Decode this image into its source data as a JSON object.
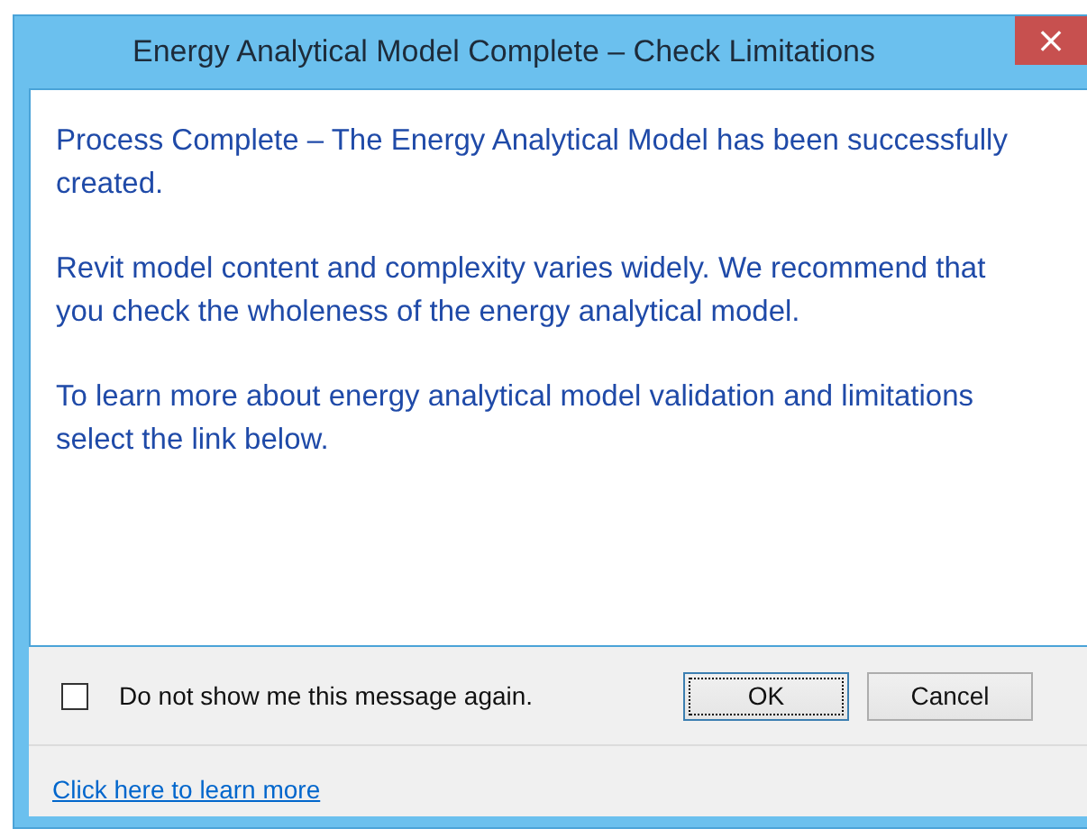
{
  "window": {
    "title": "Energy Analytical Model Complete – Check Limitations",
    "close": "×"
  },
  "message": [
    "Process Complete – The Energy Analytical Model has been successfully created.",
    "Revit model content and complexity varies widely. We recommend that you check the wholeness of the energy analytical model.",
    "To learn more about energy analytical model validation and limitations select the link below."
  ],
  "checkbox": {
    "label": "Do not show me this message again.",
    "checked": false
  },
  "buttons": [
    {
      "label": "OK",
      "default": true
    },
    {
      "label": "Cancel",
      "default": false
    }
  ],
  "link": "Click here to learn more"
}
